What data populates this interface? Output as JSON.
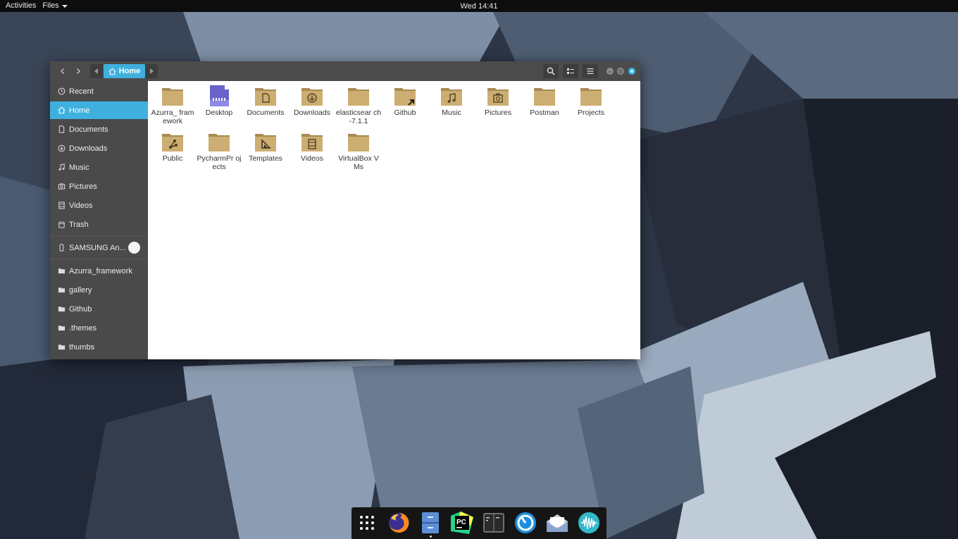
{
  "topbar": {
    "activities": "Activities",
    "app_menu": "Files",
    "clock": "Wed 14:41"
  },
  "window": {
    "path_current": "Home",
    "sidebar": {
      "places": [
        {
          "label": "Recent",
          "icon": "clock-icon"
        },
        {
          "label": "Home",
          "icon": "home-icon",
          "active": true
        },
        {
          "label": "Documents",
          "icon": "document-icon"
        },
        {
          "label": "Downloads",
          "icon": "download-icon"
        },
        {
          "label": "Music",
          "icon": "music-icon"
        },
        {
          "label": "Pictures",
          "icon": "pictures-icon"
        },
        {
          "label": "Videos",
          "icon": "video-icon"
        },
        {
          "label": "Trash",
          "icon": "trash-icon"
        }
      ],
      "device": {
        "label": "SAMSUNG An...",
        "icon": "phone-icon"
      },
      "bookmarks": [
        {
          "label": "Azurra_framework"
        },
        {
          "label": "gallery"
        },
        {
          "label": "Github"
        },
        {
          "label": ".themes"
        },
        {
          "label": "thumbs"
        }
      ]
    },
    "files": [
      {
        "name": "Azurra_ framework",
        "icon": "folder-icon"
      },
      {
        "name": "Desktop",
        "icon": "desktop-folder-icon"
      },
      {
        "name": "Documents",
        "icon": "documents-folder-icon"
      },
      {
        "name": "Downloads",
        "icon": "downloads-folder-icon"
      },
      {
        "name": "elasticsear ch-7.1.1",
        "icon": "folder-icon"
      },
      {
        "name": "Github",
        "icon": "folder-link-icon"
      },
      {
        "name": "Music",
        "icon": "music-folder-icon"
      },
      {
        "name": "Pictures",
        "icon": "pictures-folder-icon"
      },
      {
        "name": "Postman",
        "icon": "folder-icon"
      },
      {
        "name": "Projects",
        "icon": "folder-icon"
      },
      {
        "name": "Public",
        "icon": "public-folder-icon"
      },
      {
        "name": "PycharmPr ojects",
        "icon": "folder-icon"
      },
      {
        "name": "Templates",
        "icon": "templates-folder-icon"
      },
      {
        "name": "Videos",
        "icon": "videos-folder-icon"
      },
      {
        "name": "VirtualBox VMs",
        "icon": "folder-icon"
      }
    ]
  },
  "dock": {
    "apps": [
      "app-grid-icon",
      "firefox-icon",
      "files-icon",
      "pycharm-icon",
      "terminal-icon",
      "clock-app-icon",
      "mail-icon",
      "audio-recorder-icon"
    ],
    "pycharm_text": "PC"
  },
  "colors": {
    "accent": "#3fb0de",
    "folder": "#c8a86b",
    "sidebar_bg": "#4a4a4a",
    "headerbar_bg": "#4b4b4b"
  }
}
